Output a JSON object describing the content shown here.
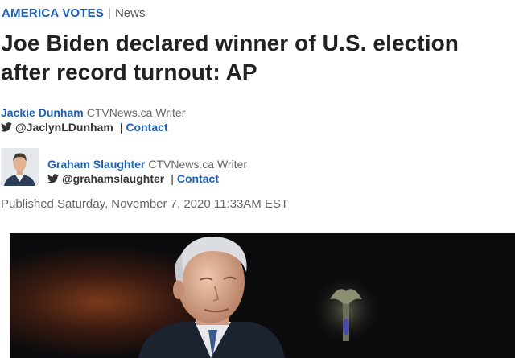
{
  "section": {
    "main": "AMERICA VOTES",
    "separator": "|",
    "sub": "News"
  },
  "headline": "Joe Biden declared winner of U.S. election after record turnout: AP",
  "authors": [
    {
      "name": "Jackie Dunham",
      "role": "CTVNews.ca Writer",
      "twitter": "@JaclynLDunham",
      "separator": "|",
      "contact": "Contact"
    },
    {
      "name": "Graham Slaughter",
      "role": "CTVNews.ca Writer",
      "twitter": "@grahamslaughter",
      "separator": "|",
      "contact": "Contact"
    }
  ],
  "published": "Published Saturday, November 7, 2020 11:33AM EST",
  "icons": {
    "twitter": "twitter-bird-icon"
  },
  "colors": {
    "accent": "#1d5fb3",
    "text": "#222222",
    "muted": "#666666"
  }
}
